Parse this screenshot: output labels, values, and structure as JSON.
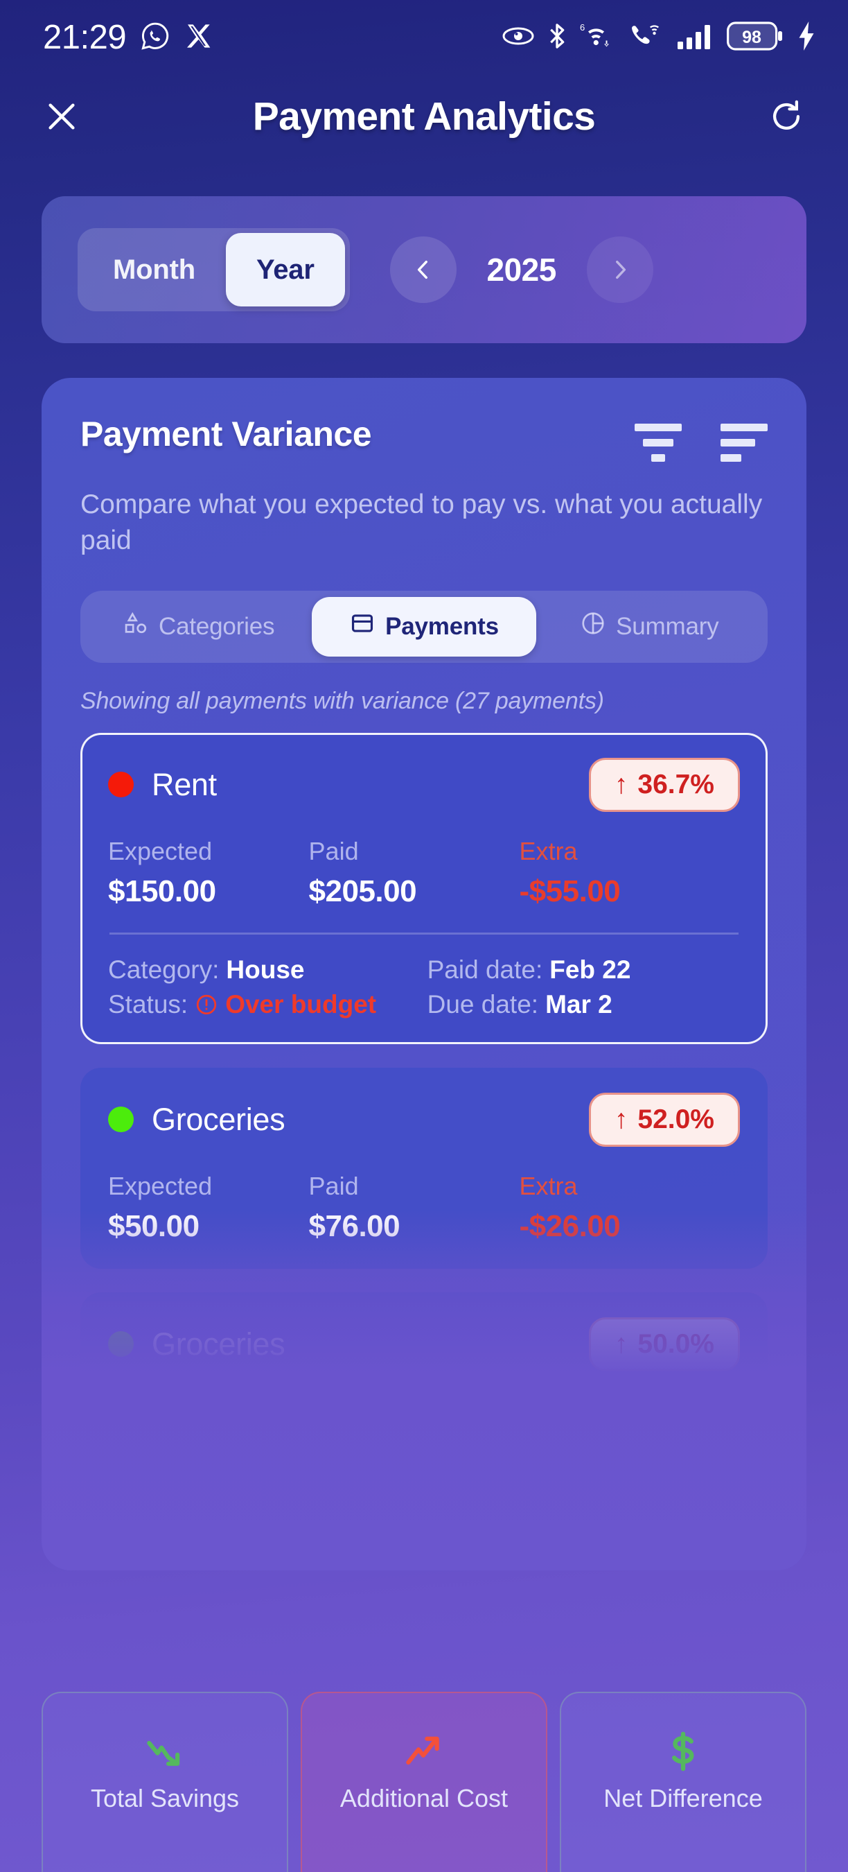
{
  "status_bar": {
    "time": "21:29",
    "left_icons": [
      "whatsapp-icon",
      "x-twitter-icon"
    ],
    "right_icons": [
      "eye-icon",
      "bluetooth-icon",
      "wifi-6-icon",
      "call-wifi-icon",
      "signal-icon"
    ],
    "wifi_label": "6",
    "battery_level": "98",
    "charging": true
  },
  "header": {
    "close_label": "✕",
    "title": "Payment Analytics",
    "refresh_label": "↻"
  },
  "period_bar": {
    "segments": [
      {
        "label": "Month",
        "active": false
      },
      {
        "label": "Year",
        "active": true
      }
    ],
    "prev_label": "‹",
    "year": "2025",
    "next_label": "›"
  },
  "variance_card": {
    "title": "Payment Variance",
    "filter_icon": "filter-icon",
    "sort_icon": "sort-icon",
    "subtitle": "Compare what you expected to pay vs. what you actually paid",
    "tabs": [
      {
        "label": "Categories",
        "icon": "shapes-icon",
        "active": false
      },
      {
        "label": "Payments",
        "icon": "card-icon",
        "active": true
      },
      {
        "label": "Summary",
        "icon": "pie-chart-icon",
        "active": false
      }
    ],
    "showing_text": "Showing all payments with variance (27 payments)",
    "column_labels": {
      "expected": "Expected",
      "paid": "Paid",
      "extra": "Extra"
    },
    "meta_labels": {
      "category": "Category:",
      "paid_date": "Paid date:",
      "status": "Status:",
      "due_date": "Due date:"
    },
    "payments": [
      {
        "name": "Rent",
        "dot_color": "#f51a09",
        "variance_arrow": "↑",
        "variance_pct": "36.7%",
        "expected": "$150.00",
        "paid": "$205.00",
        "extra": "-$55.00",
        "category": "House",
        "paid_date": "Feb 22",
        "status": "Over budget",
        "status_icon": "alert-circle-icon",
        "due_date": "Mar 2",
        "highlighted": true
      },
      {
        "name": "Groceries",
        "dot_color": "#4cec0c",
        "variance_arrow": "↑",
        "variance_pct": "52.0%",
        "expected": "$50.00",
        "paid": "$76.00",
        "extra": "-$26.00",
        "highlighted": false
      },
      {
        "name": "Groceries",
        "dot_color": "#4cec0c",
        "variance_arrow": "↑",
        "variance_pct": "50.0%",
        "highlighted": false
      }
    ]
  },
  "bottom_stats": [
    {
      "label": "Total Savings",
      "icon": "trend-down-icon",
      "color": "#55b85e"
    },
    {
      "label": "Additional Cost",
      "icon": "trend-up-icon",
      "color": "#f4503a"
    },
    {
      "label": "Net Difference",
      "icon": "dollar-icon",
      "color": "#55b85e"
    }
  ],
  "colors": {
    "accent_red": "#e93c2c",
    "accent_green": "#4cec0c",
    "badge_bg": "#fdeeec",
    "card_white": "#f2f4fe"
  }
}
